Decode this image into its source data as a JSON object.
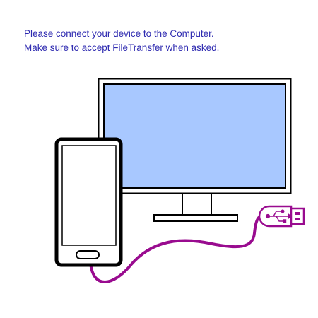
{
  "instructions": {
    "line1": "Please connect your device to the Computer.",
    "line2": "Make sure to accept FileTransfer when asked."
  },
  "illustration": {
    "monitor_screen_color": "#a8c8ff",
    "outline_color": "#000000",
    "cable_color": "#990b8f",
    "text_color": "#2e2ab0",
    "icons": [
      "monitor-icon",
      "phone-icon",
      "usb-cable-icon",
      "usb-symbol-icon"
    ]
  }
}
